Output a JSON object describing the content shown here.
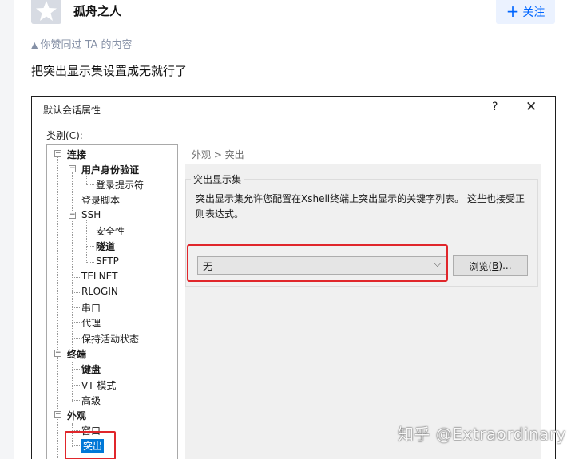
{
  "author": {
    "name": "孤舟之人"
  },
  "follow_button": {
    "icon": "plus-icon",
    "label": "关注"
  },
  "upvote_note": {
    "icon": "triangle-up-icon",
    "text": "你赞同过 TA 的内容"
  },
  "answer": {
    "text": "把突出显示集设置成无就行了"
  },
  "dialog": {
    "title": "默认会话属性",
    "help": "?",
    "close": "✕",
    "category_label_prefix": "类别(",
    "category_label_key": "C",
    "category_label_suffix": "):",
    "tree": {
      "connection": "连接",
      "auth": "用户身份验证",
      "login_prompt": "登录提示符",
      "login_script": "登录脚本",
      "ssh": "SSH",
      "security": "安全性",
      "tunnel": "隧道",
      "sftp": "SFTP",
      "telnet": "TELNET",
      "rlogin": "RLOGIN",
      "serial": "串口",
      "proxy": "代理",
      "keepalive": "保持活动状态",
      "terminal": "终端",
      "keyboard": "键盘",
      "vt_mode": "VT 模式",
      "advanced": "高级",
      "appearance": "外观",
      "window": "窗口",
      "highlight": "突出"
    },
    "breadcrumb": "外观 > 突出",
    "group": {
      "title": "突出显示集",
      "description": "突出显示集允许您配置在Xshell终端上突出显示的关键字列表。 这些也接受正则表达式。",
      "select_value": "无",
      "browse_label_prefix": "浏览(",
      "browse_label_key": "B",
      "browse_label_suffix": ")..."
    }
  },
  "watermark": "知乎 @Extraordinary",
  "colors": {
    "accent": "#0066ff",
    "highlight_red": "#e0262b",
    "selection_blue": "#0078d7"
  }
}
